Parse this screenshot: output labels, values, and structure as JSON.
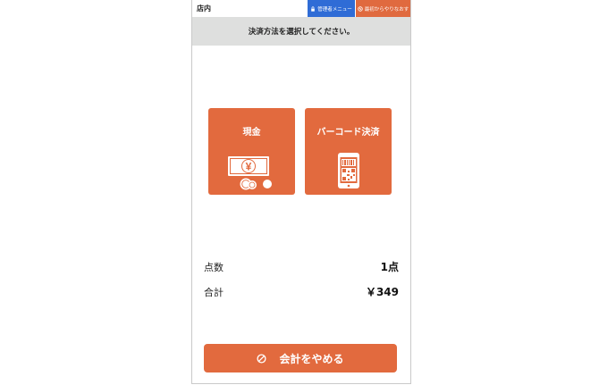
{
  "topbar": {
    "store_label": "店内",
    "admin_menu_label": "管理者メニュー",
    "restart_label": "最初からやりなおす"
  },
  "header": {
    "instruction": "決済方法を選択してください。"
  },
  "payment_options": [
    {
      "label": "現金",
      "icon": "cash-icon"
    },
    {
      "label": "バーコード決済",
      "icon": "barcode-phone-icon"
    }
  ],
  "summary": {
    "count_label": "点数",
    "count_value": "1点",
    "total_label": "合計",
    "total_value": "￥349"
  },
  "cancel": {
    "label": "会計をやめる",
    "icon": "prohibited-icon"
  },
  "colors": {
    "accent": "#e26a3e",
    "admin": "#2f6cd6",
    "header_bg": "#dedfde"
  }
}
